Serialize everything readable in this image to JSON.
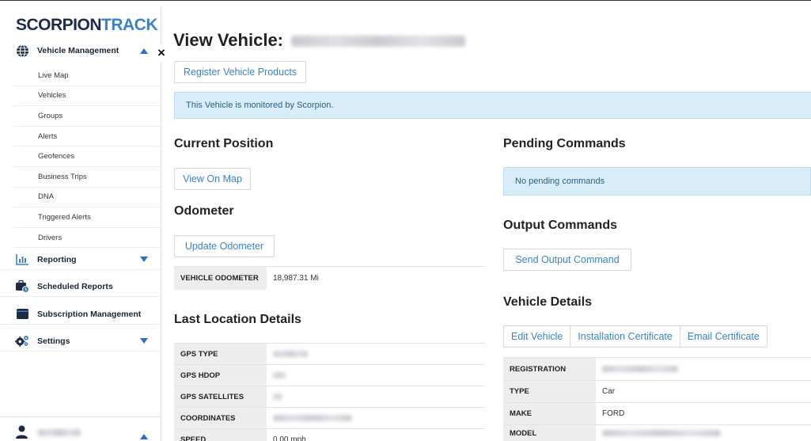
{
  "sidebar": {
    "logo_part1": "SCORPION",
    "logo_part2": "TRACK",
    "vehicle_management": "Vehicle Management",
    "sub_items": [
      "Live Map",
      "Vehicles",
      "Groups",
      "Alerts",
      "Geofences",
      "Business Trips",
      "DNA",
      "Triggered Alerts",
      "Drivers"
    ],
    "reporting": "Reporting",
    "scheduled_reports": "Scheduled Reports",
    "subscription_management": "Subscription Management",
    "settings": "Settings",
    "close_glyph": "×"
  },
  "colors": {
    "brand_dark": "#1f2a44",
    "brand_accent": "#3b82c4",
    "alert_bg": "#d8edf8",
    "alert_text": "#2b6283"
  },
  "page": {
    "title": "View Vehicle:",
    "register_button": "Register Vehicle Products",
    "monitored_alert": "This Vehicle is monitored by Scorpion."
  },
  "current_position": {
    "heading": "Current Position",
    "view_on_map": "View On Map"
  },
  "odometer": {
    "heading": "Odometer",
    "update_button": "Update Odometer",
    "label": "VEHICLE ODOMETER",
    "value": "18,987.31 Mi"
  },
  "last_location": {
    "heading": "Last Location Details",
    "rows": [
      {
        "label": "GPS TYPE",
        "value": ""
      },
      {
        "label": "GPS HDOP",
        "value": ""
      },
      {
        "label": "GPS SATELLITES",
        "value": ""
      },
      {
        "label": "COORDINATES",
        "value": ""
      },
      {
        "label": "SPEED",
        "value": "0.00 mph"
      }
    ]
  },
  "pending_commands": {
    "heading": "Pending Commands",
    "empty_text": "No pending commands"
  },
  "output_commands": {
    "heading": "Output Commands",
    "send_button": "Send Output Command"
  },
  "vehicle_details": {
    "heading": "Vehicle Details",
    "buttons": [
      "Edit Vehicle",
      "Installation Certificate",
      "Email Certificate"
    ],
    "rows": [
      {
        "label": "REGISTRATION",
        "value": ""
      },
      {
        "label": "TYPE",
        "value": "Car"
      },
      {
        "label": "MAKE",
        "value": "FORD"
      },
      {
        "label": "MODEL",
        "value": ""
      }
    ]
  }
}
